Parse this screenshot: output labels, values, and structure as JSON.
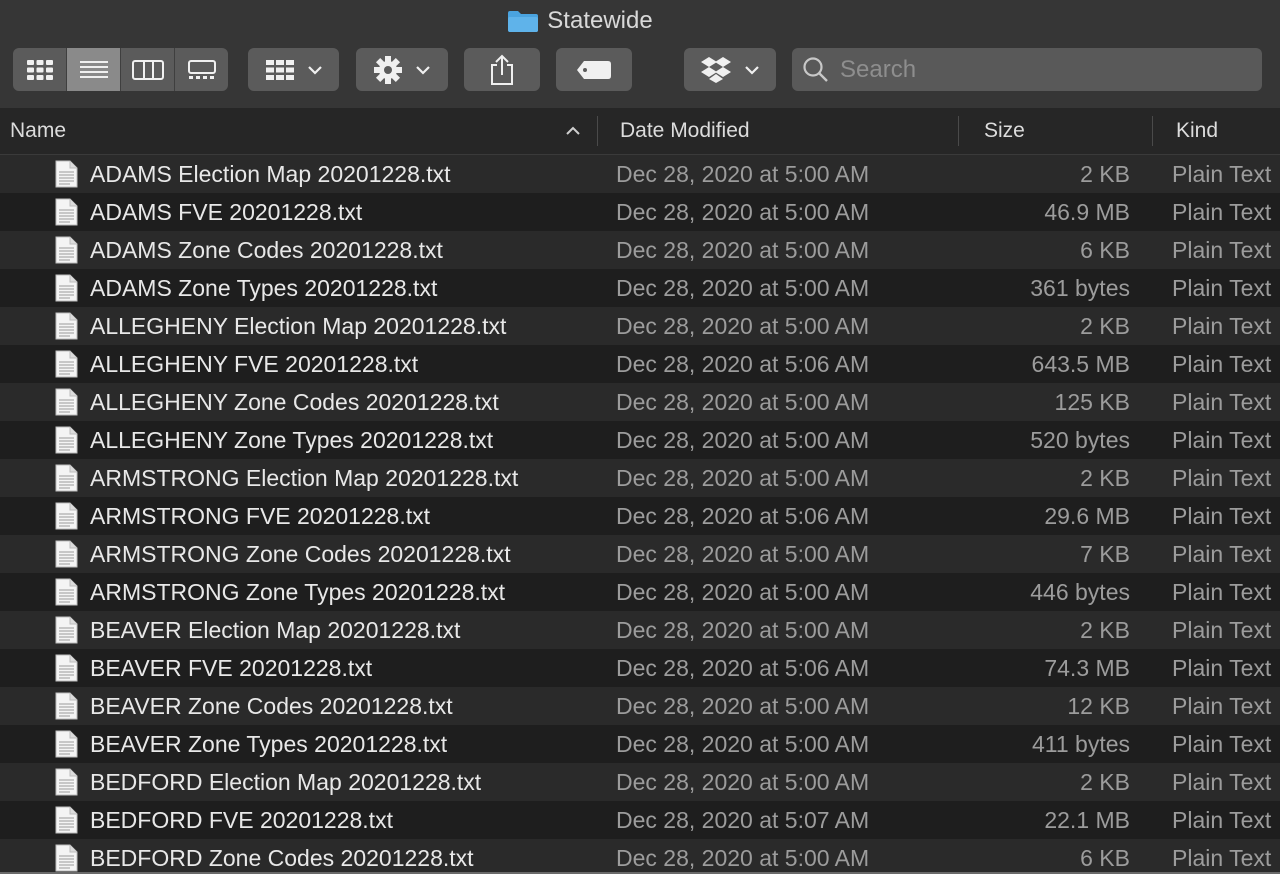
{
  "window": {
    "title": "Statewide",
    "title_icon": "folder-icon"
  },
  "toolbar": {
    "view_modes": [
      {
        "name": "icon-view",
        "icon": "grid-icon",
        "active": false
      },
      {
        "name": "list-view",
        "icon": "list-icon",
        "active": true
      },
      {
        "name": "column-view",
        "icon": "columns-icon",
        "active": false
      },
      {
        "name": "gallery-view",
        "icon": "gallery-icon",
        "active": false
      }
    ],
    "group_icon": "group-by-icon",
    "action_icon": "gear-icon",
    "share_icon": "share-icon",
    "tag_icon": "tag-icon",
    "dropbox_icon": "dropbox-icon",
    "search_placeholder": "Search"
  },
  "columns": {
    "name": "Name",
    "date": "Date Modified",
    "size": "Size",
    "kind": "Kind",
    "sort_indicator": "^"
  },
  "files": [
    {
      "name": "ADAMS Election Map 20201228.txt",
      "date": "Dec 28, 2020 at 5:00 AM",
      "size": "2 KB",
      "kind": "Plain Text"
    },
    {
      "name": "ADAMS FVE 20201228.txt",
      "date": "Dec 28, 2020 at 5:00 AM",
      "size": "46.9 MB",
      "kind": "Plain Text"
    },
    {
      "name": "ADAMS Zone Codes 20201228.txt",
      "date": "Dec 28, 2020 at 5:00 AM",
      "size": "6 KB",
      "kind": "Plain Text"
    },
    {
      "name": "ADAMS Zone Types 20201228.txt",
      "date": "Dec 28, 2020 at 5:00 AM",
      "size": "361 bytes",
      "kind": "Plain Text"
    },
    {
      "name": "ALLEGHENY Election Map 20201228.txt",
      "date": "Dec 28, 2020 at 5:00 AM",
      "size": "2 KB",
      "kind": "Plain Text"
    },
    {
      "name": "ALLEGHENY FVE 20201228.txt",
      "date": "Dec 28, 2020 at 5:06 AM",
      "size": "643.5 MB",
      "kind": "Plain Text"
    },
    {
      "name": "ALLEGHENY Zone Codes 20201228.txt",
      "date": "Dec 28, 2020 at 5:00 AM",
      "size": "125 KB",
      "kind": "Plain Text"
    },
    {
      "name": "ALLEGHENY Zone Types 20201228.txt",
      "date": "Dec 28, 2020 at 5:00 AM",
      "size": "520 bytes",
      "kind": "Plain Text"
    },
    {
      "name": "ARMSTRONG Election Map 20201228.txt",
      "date": "Dec 28, 2020 at 5:00 AM",
      "size": "2 KB",
      "kind": "Plain Text"
    },
    {
      "name": "ARMSTRONG FVE 20201228.txt",
      "date": "Dec 28, 2020 at 5:06 AM",
      "size": "29.6 MB",
      "kind": "Plain Text"
    },
    {
      "name": "ARMSTRONG Zone Codes 20201228.txt",
      "date": "Dec 28, 2020 at 5:00 AM",
      "size": "7 KB",
      "kind": "Plain Text"
    },
    {
      "name": "ARMSTRONG Zone Types 20201228.txt",
      "date": "Dec 28, 2020 at 5:00 AM",
      "size": "446 bytes",
      "kind": "Plain Text"
    },
    {
      "name": "BEAVER Election Map 20201228.txt",
      "date": "Dec 28, 2020 at 5:00 AM",
      "size": "2 KB",
      "kind": "Plain Text"
    },
    {
      "name": "BEAVER FVE 20201228.txt",
      "date": "Dec 28, 2020 at 5:06 AM",
      "size": "74.3 MB",
      "kind": "Plain Text"
    },
    {
      "name": "BEAVER Zone Codes 20201228.txt",
      "date": "Dec 28, 2020 at 5:00 AM",
      "size": "12 KB",
      "kind": "Plain Text"
    },
    {
      "name": "BEAVER Zone Types 20201228.txt",
      "date": "Dec 28, 2020 at 5:00 AM",
      "size": "411 bytes",
      "kind": "Plain Text"
    },
    {
      "name": "BEDFORD Election Map 20201228.txt",
      "date": "Dec 28, 2020 at 5:00 AM",
      "size": "2 KB",
      "kind": "Plain Text"
    },
    {
      "name": "BEDFORD FVE 20201228.txt",
      "date": "Dec 28, 2020 at 5:07 AM",
      "size": "22.1 MB",
      "kind": "Plain Text"
    },
    {
      "name": "BEDFORD Zone Codes 20201228.txt",
      "date": "Dec 28, 2020 at 5:00 AM",
      "size": "6 KB",
      "kind": "Plain Text"
    }
  ],
  "colors": {
    "background": "#1e1e1e",
    "row_alt": "#2a2a2a",
    "toolbar": "#363636",
    "button": "#5b5b5b",
    "active_segment": "#8a8a8a",
    "folder_blue": "#4aa3df"
  }
}
